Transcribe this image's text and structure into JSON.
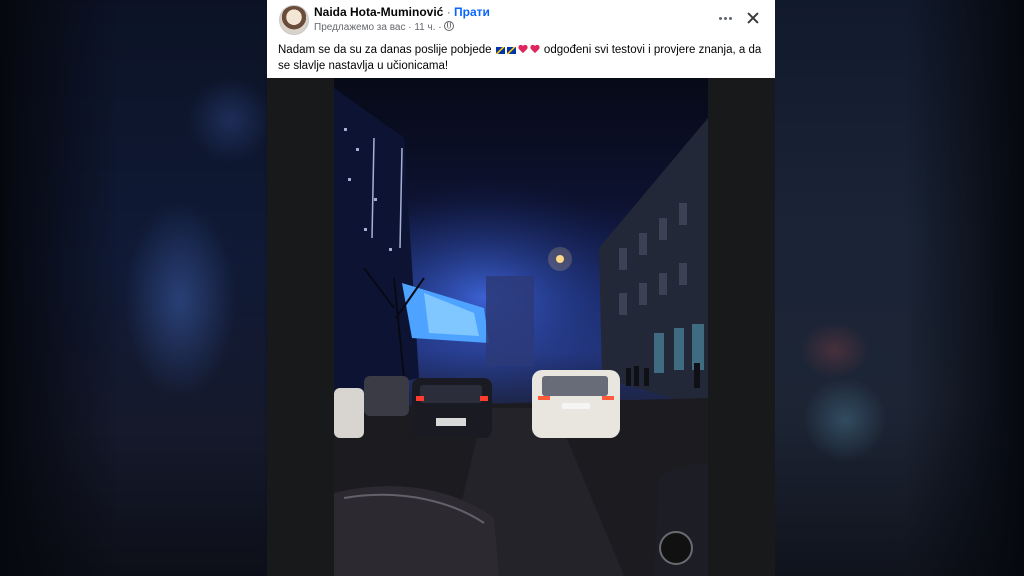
{
  "post": {
    "author": "Naida Hota-Muminović",
    "separator": "·",
    "follow_label": "Прати",
    "meta": "Предлажемо за вас · 11 ч. ·",
    "text_before_emoji": "Nadam se da su za danas poslije pobjede ",
    "text_after_emoji": " odgođeni svi testovi i provjere znanja, a da se slavlje nastavlja u učionicama!",
    "emoji": [
      "flag-bosnia-icon",
      "flag-bosnia-icon",
      "heart-icon",
      "heart-icon"
    ],
    "privacy_icon": "globe-icon",
    "actions": {
      "more_icon": "more-options-icon",
      "close_icon": "close-icon"
    },
    "photo_alt": "night street traffic with a large illuminated screen showing the flag"
  },
  "colors": {
    "follow": "#0866ff",
    "heart": "#e0245e",
    "card_bg": "#ffffff",
    "frame_bg": "#18191a"
  }
}
